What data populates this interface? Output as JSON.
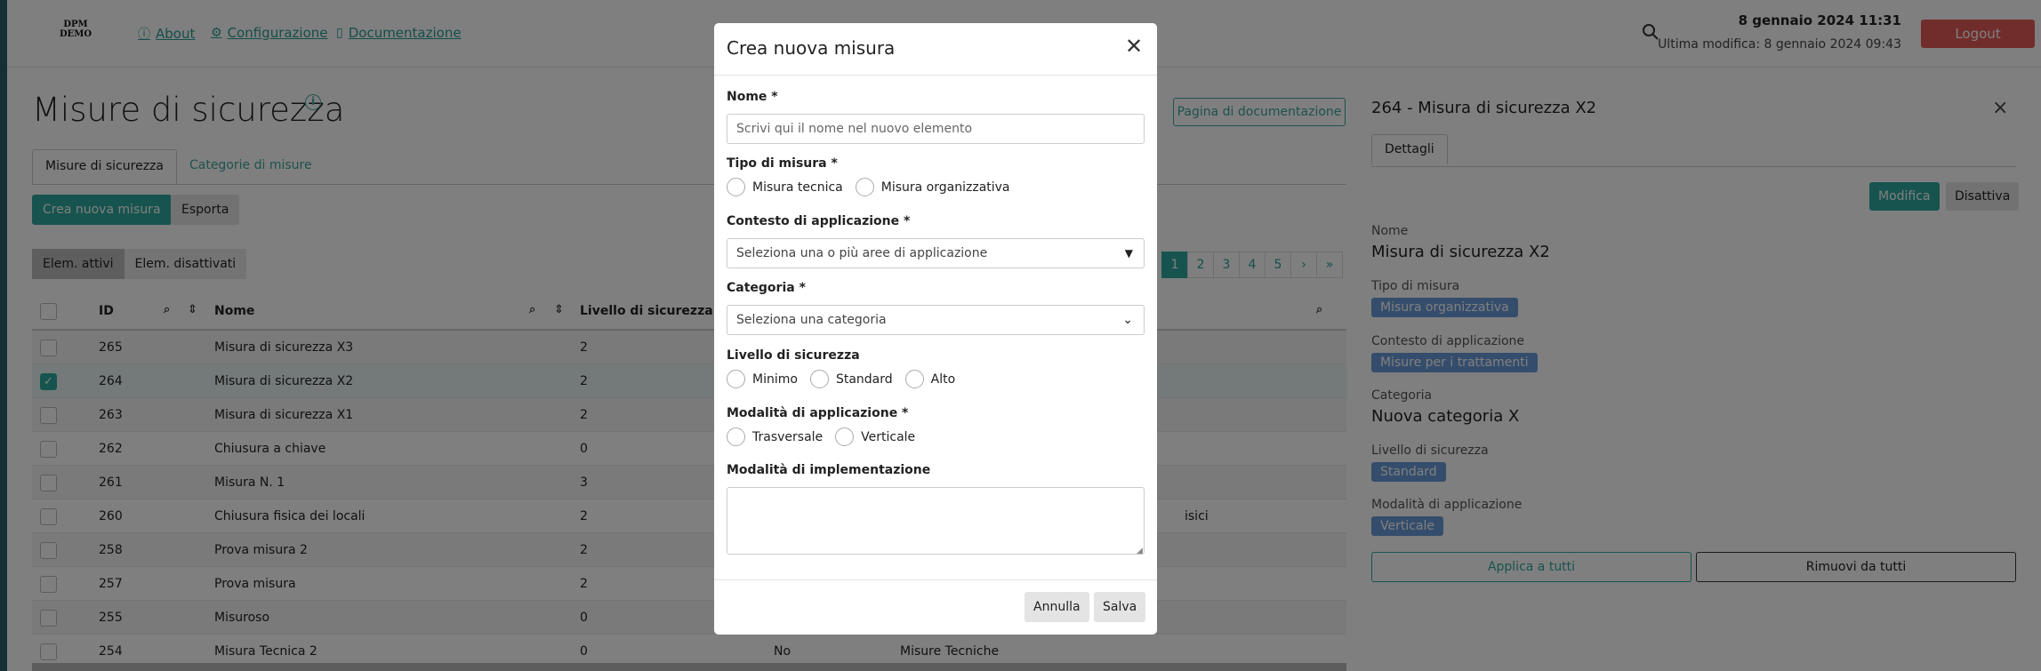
{
  "header": {
    "logo_line1": "DPM",
    "logo_line2": "DEMO",
    "nav": [
      {
        "label": "About",
        "icon": "info-icon"
      },
      {
        "label": "Configurazione",
        "icon": "gear-icon"
      },
      {
        "label": "Documentazione",
        "icon": "book-icon"
      }
    ],
    "date": "8 gennaio 2024 11:31",
    "last_modified": "Ultima modifica: 8 gennaio 2024 09:43",
    "logout_label": "Logout"
  },
  "page": {
    "title": "Misure di sicurezza",
    "doc_button": "Pagina di documentazione",
    "tabs": [
      "Misure di sicurezza",
      "Categorie di misure"
    ],
    "create_button": "Crea nuova misura",
    "export_button": "Esporta",
    "filter_active": "Elem. attivi",
    "filter_inactive": "Elem. disattivati",
    "pager": [
      "1",
      "2",
      "3",
      "4",
      "5",
      "›",
      "»"
    ]
  },
  "table": {
    "headers": {
      "id": "ID",
      "name": "Nome",
      "level": "Livello di sicurezza"
    },
    "rows": [
      {
        "id": "265",
        "name": "Misura di sicurezza X3",
        "level": "2",
        "extra1": "",
        "extra2": "",
        "checked": false
      },
      {
        "id": "264",
        "name": "Misura di sicurezza X2",
        "level": "2",
        "extra1": "",
        "extra2": "",
        "checked": true
      },
      {
        "id": "263",
        "name": "Misura di sicurezza X1",
        "level": "2",
        "extra1": "",
        "extra2": "",
        "checked": false
      },
      {
        "id": "262",
        "name": "Chiusura a chiave",
        "level": "0",
        "extra1": "",
        "extra2": "",
        "checked": false
      },
      {
        "id": "261",
        "name": "Misura N. 1",
        "level": "3",
        "extra1": "",
        "extra2": "",
        "checked": false
      },
      {
        "id": "260",
        "name": "Chiusura fisica dei locali",
        "level": "2",
        "extra1": "",
        "extra2": "isici",
        "checked": false
      },
      {
        "id": "258",
        "name": "Prova misura 2",
        "level": "2",
        "extra1": "",
        "extra2": "",
        "checked": false
      },
      {
        "id": "257",
        "name": "Prova misura",
        "level": "2",
        "extra1": "",
        "extra2": "",
        "checked": false
      },
      {
        "id": "255",
        "name": "Misuroso",
        "level": "0",
        "extra1": "",
        "extra2": "",
        "checked": false
      },
      {
        "id": "254",
        "name": "Misura Tecnica 2",
        "level": "0",
        "extra1": "No",
        "extra2": "Misure Tecniche",
        "checked": false
      }
    ]
  },
  "panel": {
    "title": "264 - Misura di sicurezza X2",
    "tab": "Dettagli",
    "edit_button": "Modifica",
    "disable_button": "Disattiva",
    "fields": {
      "name_label": "Nome",
      "name_value": "Misura di sicurezza X2",
      "type_label": "Tipo di misura",
      "type_value": "Misura organizzativa",
      "context_label": "Contesto di applicazione",
      "context_value": "Misure per i trattamenti",
      "category_label": "Categoria",
      "category_value": "Nuova categoria X",
      "level_label": "Livello di sicurezza",
      "level_value": "Standard",
      "mode_label": "Modalità di applicazione",
      "mode_value": "Verticale"
    },
    "apply_all": "Applica a tutti",
    "remove_all": "Rimuovi da tutti"
  },
  "modal": {
    "title": "Crea nuova misura",
    "name_label": "Nome *",
    "name_placeholder": "Scrivi qui il nome nel nuovo elemento",
    "type_label": "Tipo di misura *",
    "type_options": [
      "Misura tecnica",
      "Misura organizzativa"
    ],
    "context_label": "Contesto di applicazione *",
    "context_placeholder": "Seleziona una o più aree di applicazione",
    "category_label": "Categoria *",
    "category_placeholder": "Seleziona una categoria",
    "level_label": "Livello di sicurezza",
    "level_options": [
      "Minimo",
      "Standard",
      "Alto"
    ],
    "mode_label": "Modalità di applicazione *",
    "mode_options": [
      "Trasversale",
      "Verticale"
    ],
    "impl_label": "Modalità di implementazione",
    "cancel_button": "Annulla",
    "save_button": "Salva"
  },
  "colors": {
    "accent": "#2ea99f",
    "logout": "#e25a57",
    "badge": "#6b9bd8"
  }
}
